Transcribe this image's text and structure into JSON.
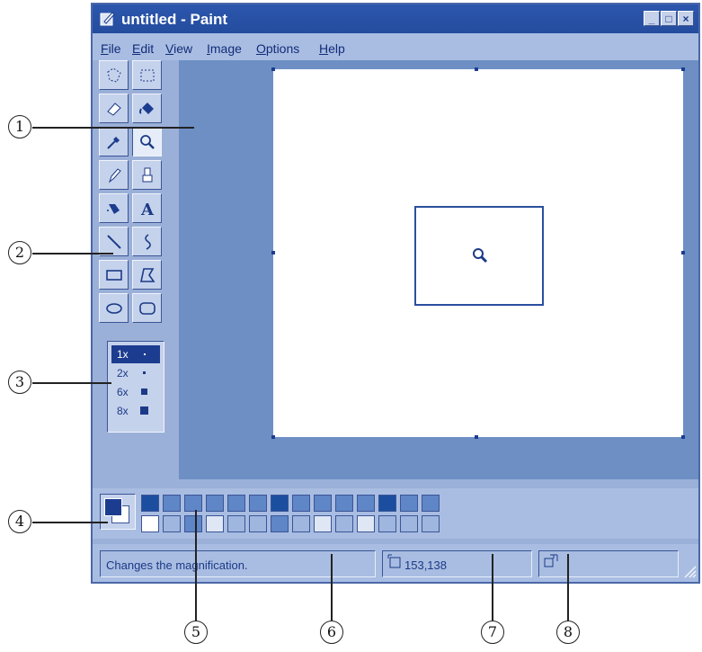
{
  "window": {
    "title": "untitled - Paint",
    "controls": [
      "_",
      "□",
      "×"
    ]
  },
  "menu": [
    {
      "label": "File",
      "hotkey": "F",
      "rest": "ile"
    },
    {
      "label": "Edit",
      "hotkey": "E",
      "rest": "dit"
    },
    {
      "label": "View",
      "hotkey": "V",
      "rest": "iew"
    },
    {
      "label": "Image",
      "hotkey": "I",
      "rest": "mage"
    },
    {
      "label": "Options",
      "hotkey": "O",
      "rest": "ptions"
    },
    {
      "label": "Help",
      "hotkey": "H",
      "rest": "elp"
    }
  ],
  "tools": [
    {
      "icon": "free-form-select-icon"
    },
    {
      "icon": "select-icon"
    },
    {
      "icon": "eraser-icon"
    },
    {
      "icon": "fill-bucket-icon"
    },
    {
      "icon": "pick-color-icon"
    },
    {
      "icon": "magnifier-icon",
      "selected": true
    },
    {
      "icon": "pencil-icon"
    },
    {
      "icon": "brush-icon"
    },
    {
      "icon": "airbrush-icon"
    },
    {
      "icon": "text-icon"
    },
    {
      "icon": "line-icon"
    },
    {
      "icon": "curve-icon"
    },
    {
      "icon": "rectangle-icon"
    },
    {
      "icon": "polygon-icon"
    },
    {
      "icon": "ellipse-icon"
    },
    {
      "icon": "rounded-rectangle-icon"
    }
  ],
  "zoom_options": [
    {
      "label": "1x",
      "selected": true
    },
    {
      "label": "2x"
    },
    {
      "label": "6x"
    },
    {
      "label": "8x"
    }
  ],
  "palette": {
    "top_row": [
      "#1c4ea0",
      "#5f86c7",
      "#5f86c7",
      "#5f86c7",
      "#5f86c7",
      "#5f86c7",
      "#1c4ea0",
      "#5f86c7",
      "#5f86c7",
      "#5f86c7",
      "#5f86c7",
      "#1c4ea0",
      "#5f86c7",
      "#5f86c7"
    ],
    "bottom_row": [
      "#ffffff",
      "#9fb6de",
      "#5f86c7",
      "#dfe7f5",
      "#9fb6de",
      "#9fb6de",
      "#5f86c7",
      "#9fb6de",
      "#dfe7f5",
      "#9fb6de",
      "#dfe7f5",
      "#9fb6de",
      "#9fb6de",
      "#9fb6de"
    ],
    "foreground": "#1c3d8f",
    "background": "#ffffff"
  },
  "status": {
    "help_text": "Changes the magnification.",
    "coordinates": "153,138",
    "size": ""
  },
  "callouts": [
    "1",
    "2",
    "3",
    "4",
    "5",
    "6",
    "7",
    "8"
  ]
}
